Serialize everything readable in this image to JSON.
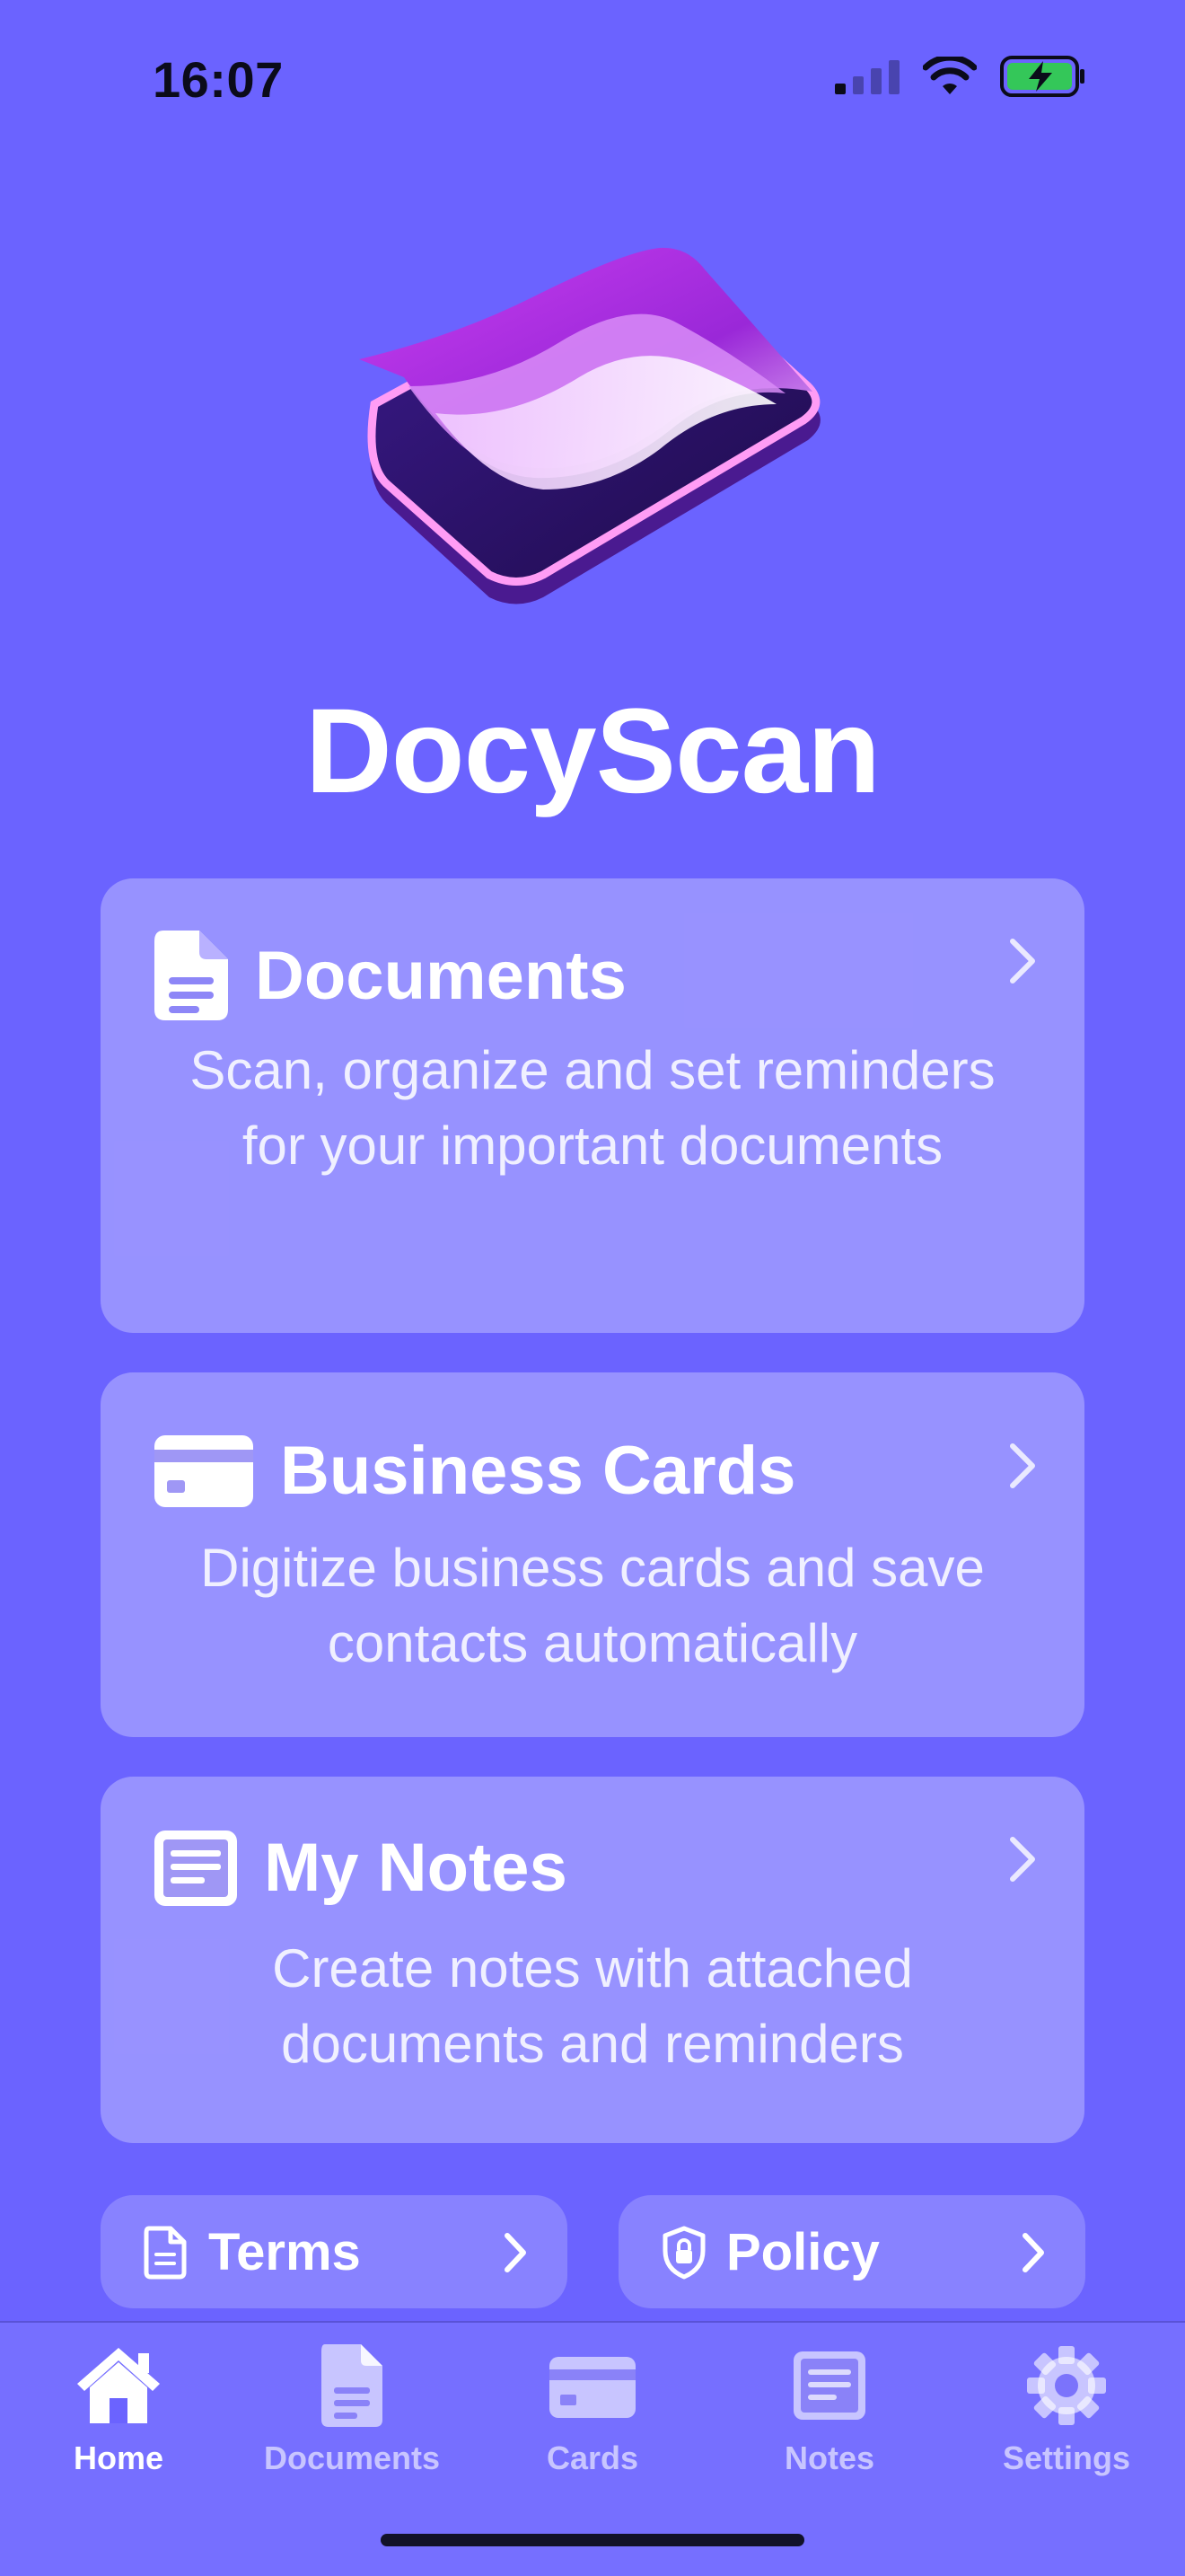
{
  "status_bar": {
    "time": "16:07"
  },
  "app": {
    "title": "DocyScan"
  },
  "cards": [
    {
      "title": "Documents",
      "description": "Scan, organize and set reminders for your important documents",
      "icon": "document-icon"
    },
    {
      "title": "Business Cards",
      "description": "Digitize business cards and save contacts automatically",
      "icon": "credit-card-icon"
    },
    {
      "title": "My Notes",
      "description": "Create notes with attached documents and reminders",
      "icon": "note-icon"
    }
  ],
  "links": [
    {
      "label": "Terms",
      "icon": "document-outline-icon"
    },
    {
      "label": "Policy",
      "icon": "shield-lock-icon"
    }
  ],
  "tabs": [
    {
      "label": "Home",
      "icon": "house-icon",
      "active": true
    },
    {
      "label": "Documents",
      "icon": "document-icon",
      "active": false
    },
    {
      "label": "Cards",
      "icon": "credit-card-icon",
      "active": false
    },
    {
      "label": "Notes",
      "icon": "note-icon",
      "active": false
    },
    {
      "label": "Settings",
      "icon": "gear-icon",
      "active": false
    }
  ],
  "colors": {
    "background": "#6b63ff",
    "battery_fill": "#34c759",
    "logo_primary": "#9b2bd9",
    "logo_dark": "#2a1263"
  }
}
